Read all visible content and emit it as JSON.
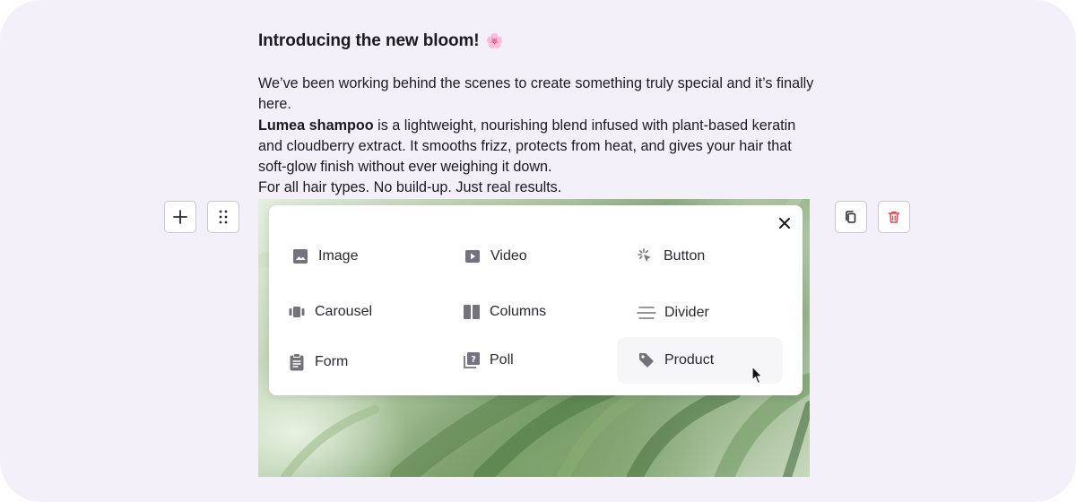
{
  "article": {
    "title": "Introducing the new bloom!",
    "title_emoji": "🌸",
    "line1": "We’ve been working behind the scenes to create something truly special and it’s finally here.",
    "product_name": "Lumea shampoo",
    "line2": " is a lightweight, nourishing blend infused with plant-based keratin and cloudberry extract. It smooths frizz, protects from heat, and gives your hair that soft-glow finish without ever weighing it down.",
    "line3": "For all hair types. No build-up. Just real results."
  },
  "block_menu": {
    "items": [
      {
        "label": "Image",
        "icon": "image-icon"
      },
      {
        "label": "Video",
        "icon": "video-icon"
      },
      {
        "label": "Button",
        "icon": "button-click-icon"
      },
      {
        "label": "Carousel",
        "icon": "carousel-icon"
      },
      {
        "label": "Columns",
        "icon": "columns-icon"
      },
      {
        "label": "Divider",
        "icon": "divider-icon"
      },
      {
        "label": "Form",
        "icon": "form-clipboard-icon"
      },
      {
        "label": "Poll",
        "icon": "poll-icon"
      },
      {
        "label": "Product",
        "icon": "tag-icon"
      }
    ],
    "hovered_item": "Product"
  },
  "colors": {
    "canvas_background": "#f4f0fa",
    "delete_icon": "#e0454f",
    "icon_gray": "#74737c"
  }
}
